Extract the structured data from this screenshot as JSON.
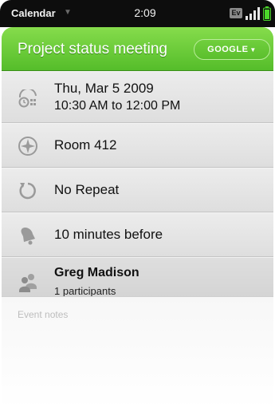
{
  "status_bar": {
    "app_name": "Calendar",
    "time": "2:09",
    "carrier": "Ev"
  },
  "header": {
    "title": "Project status meeting",
    "calendar_label": "GOOGLE"
  },
  "event": {
    "date": "Thu, Mar 5 2009",
    "time_range": "10:30 AM to 12:00 PM",
    "location": "Room 412",
    "repeat": "No Repeat",
    "reminder": "10 minutes before",
    "organizer": "Greg Madison",
    "participants": "1 participants"
  },
  "notes": {
    "placeholder": "Event notes"
  },
  "icons": {
    "status_menu": "chevron-down-icon",
    "signal": "signal-bars-icon",
    "battery": "battery-icon",
    "datetime": "clock-calendar-icon",
    "location": "compass-icon",
    "repeat": "repeat-icon",
    "reminder": "bell-icon",
    "attendees": "people-icon"
  },
  "colors": {
    "header_accent": "#5cc02f",
    "status_bar": "#0d0d0d",
    "battery": "#4bd62a"
  }
}
